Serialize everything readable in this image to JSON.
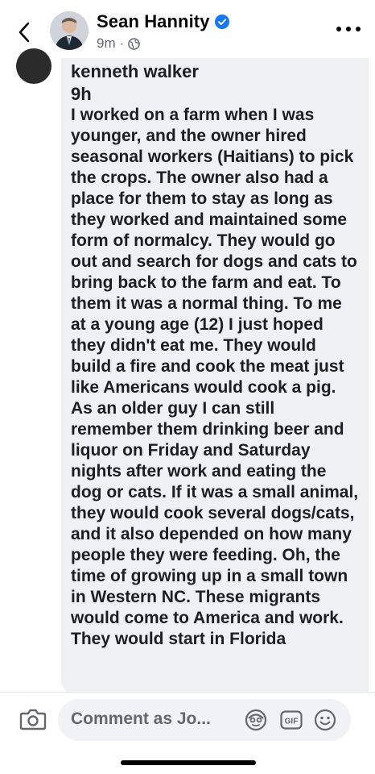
{
  "header": {
    "back_icon": "chevron-left-icon",
    "author_name": "Sean Hannity",
    "verified_icon": "verified-badge-icon",
    "post_time": "9m",
    "separator": "·",
    "audience_icon": "globe-icon",
    "more_icon": "more-horizontal-icon"
  },
  "comment": {
    "author": "kenneth walker",
    "time": "9h",
    "text": "I worked on a farm when I was younger, and the owner hired seasonal workers (Haitians) to pick the crops. The owner also had a place for them to stay as long as they worked and maintained some form of normalcy. They would go out and search for dogs and cats to bring back to the farm and eat. To them it was a normal thing. To me at a young age (12) I just hoped they didn't eat me. They would build a fire and cook the meat just like Americans would cook a pig. As an older guy I can still remember them drinking beer and liquor on Friday and Saturday nights after work and eating the dog or cats. If it was a small animal, they would cook several dogs/cats, and it also depended on how many people they were feeding. Oh, the time of growing up in a small town in Western NC. These migrants would come to America and work. They would start in Florida"
  },
  "composer": {
    "camera_icon": "camera-icon",
    "placeholder": "Comment as Jo...",
    "avatar_icon": "avatar-sticker-icon",
    "gif_label": "GIF",
    "emoji_icon": "smiley-icon"
  },
  "colors": {
    "verified_blue": "#1877f2",
    "comment_bg": "#eef0f2",
    "secondary_text": "#65676b"
  }
}
